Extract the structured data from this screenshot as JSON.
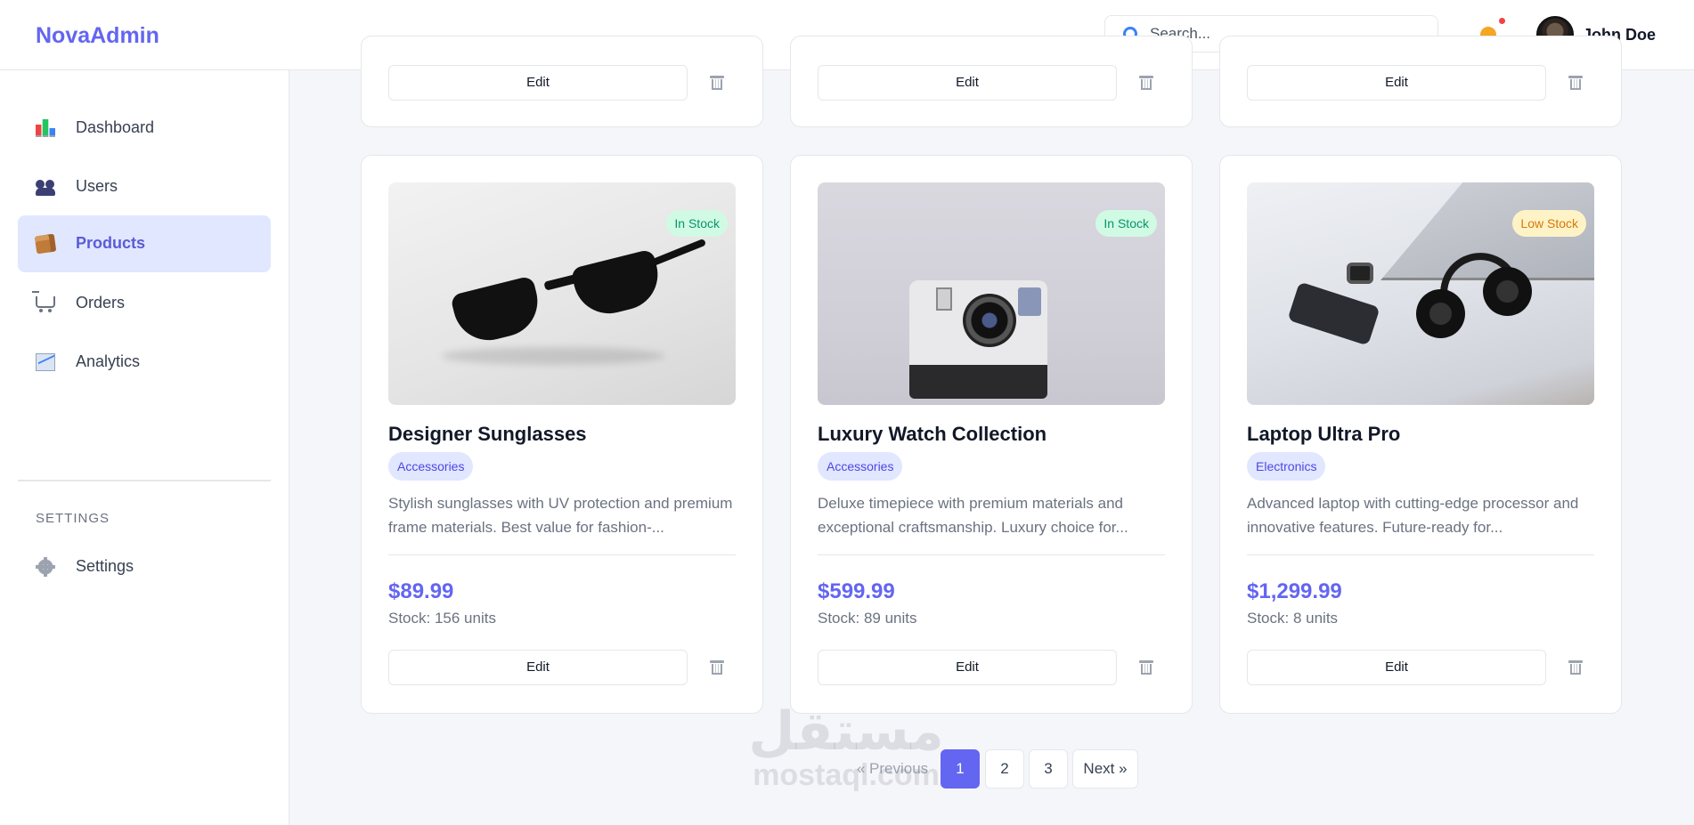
{
  "header": {
    "brand": "NovaAdmin",
    "search_placeholder": "Search...",
    "user_name": "John Doe"
  },
  "sidebar": {
    "items": [
      {
        "label": "Dashboard",
        "icon": "chart-icon"
      },
      {
        "label": "Users",
        "icon": "users-icon"
      },
      {
        "label": "Products",
        "icon": "package-icon",
        "active": true
      },
      {
        "label": "Orders",
        "icon": "cart-icon"
      },
      {
        "label": "Analytics",
        "icon": "analytics-icon"
      }
    ],
    "section_label": "SETTINGS",
    "settings_label": "Settings"
  },
  "cards_top_row": [
    {
      "edit_label": "Edit"
    },
    {
      "edit_label": "Edit"
    },
    {
      "edit_label": "Edit"
    }
  ],
  "products": [
    {
      "name": "Designer Sunglasses",
      "category": "Accessories",
      "stock_status": "In Stock",
      "description": "Stylish sunglasses with UV protection and premium frame materials. Best value for fashion-...",
      "price": "$89.99",
      "stock": "Stock: 156 units",
      "edit_label": "Edit"
    },
    {
      "name": "Luxury Watch Collection",
      "category": "Accessories",
      "stock_status": "In Stock",
      "description": "Deluxe timepiece with premium materials and exceptional craftsmanship. Luxury choice for...",
      "price": "$599.99",
      "stock": "Stock: 89 units",
      "edit_label": "Edit"
    },
    {
      "name": "Laptop Ultra Pro",
      "category": "Electronics",
      "stock_status": "Low Stock",
      "description": "Advanced laptop with cutting-edge processor and innovative features. Future-ready for...",
      "price": "$1,299.99",
      "stock": "Stock: 8 units",
      "edit_label": "Edit"
    }
  ],
  "pagination": {
    "previous": "« Previous",
    "pages": [
      "1",
      "2",
      "3"
    ],
    "current": "1",
    "next": "Next »"
  },
  "watermark": {
    "arabic": "مستقل",
    "latin": "mostaql.com"
  },
  "colors": {
    "accent": "#6366f1",
    "in_stock": "#059669",
    "low_stock": "#d97706",
    "notification_dot": "#ef4444"
  }
}
